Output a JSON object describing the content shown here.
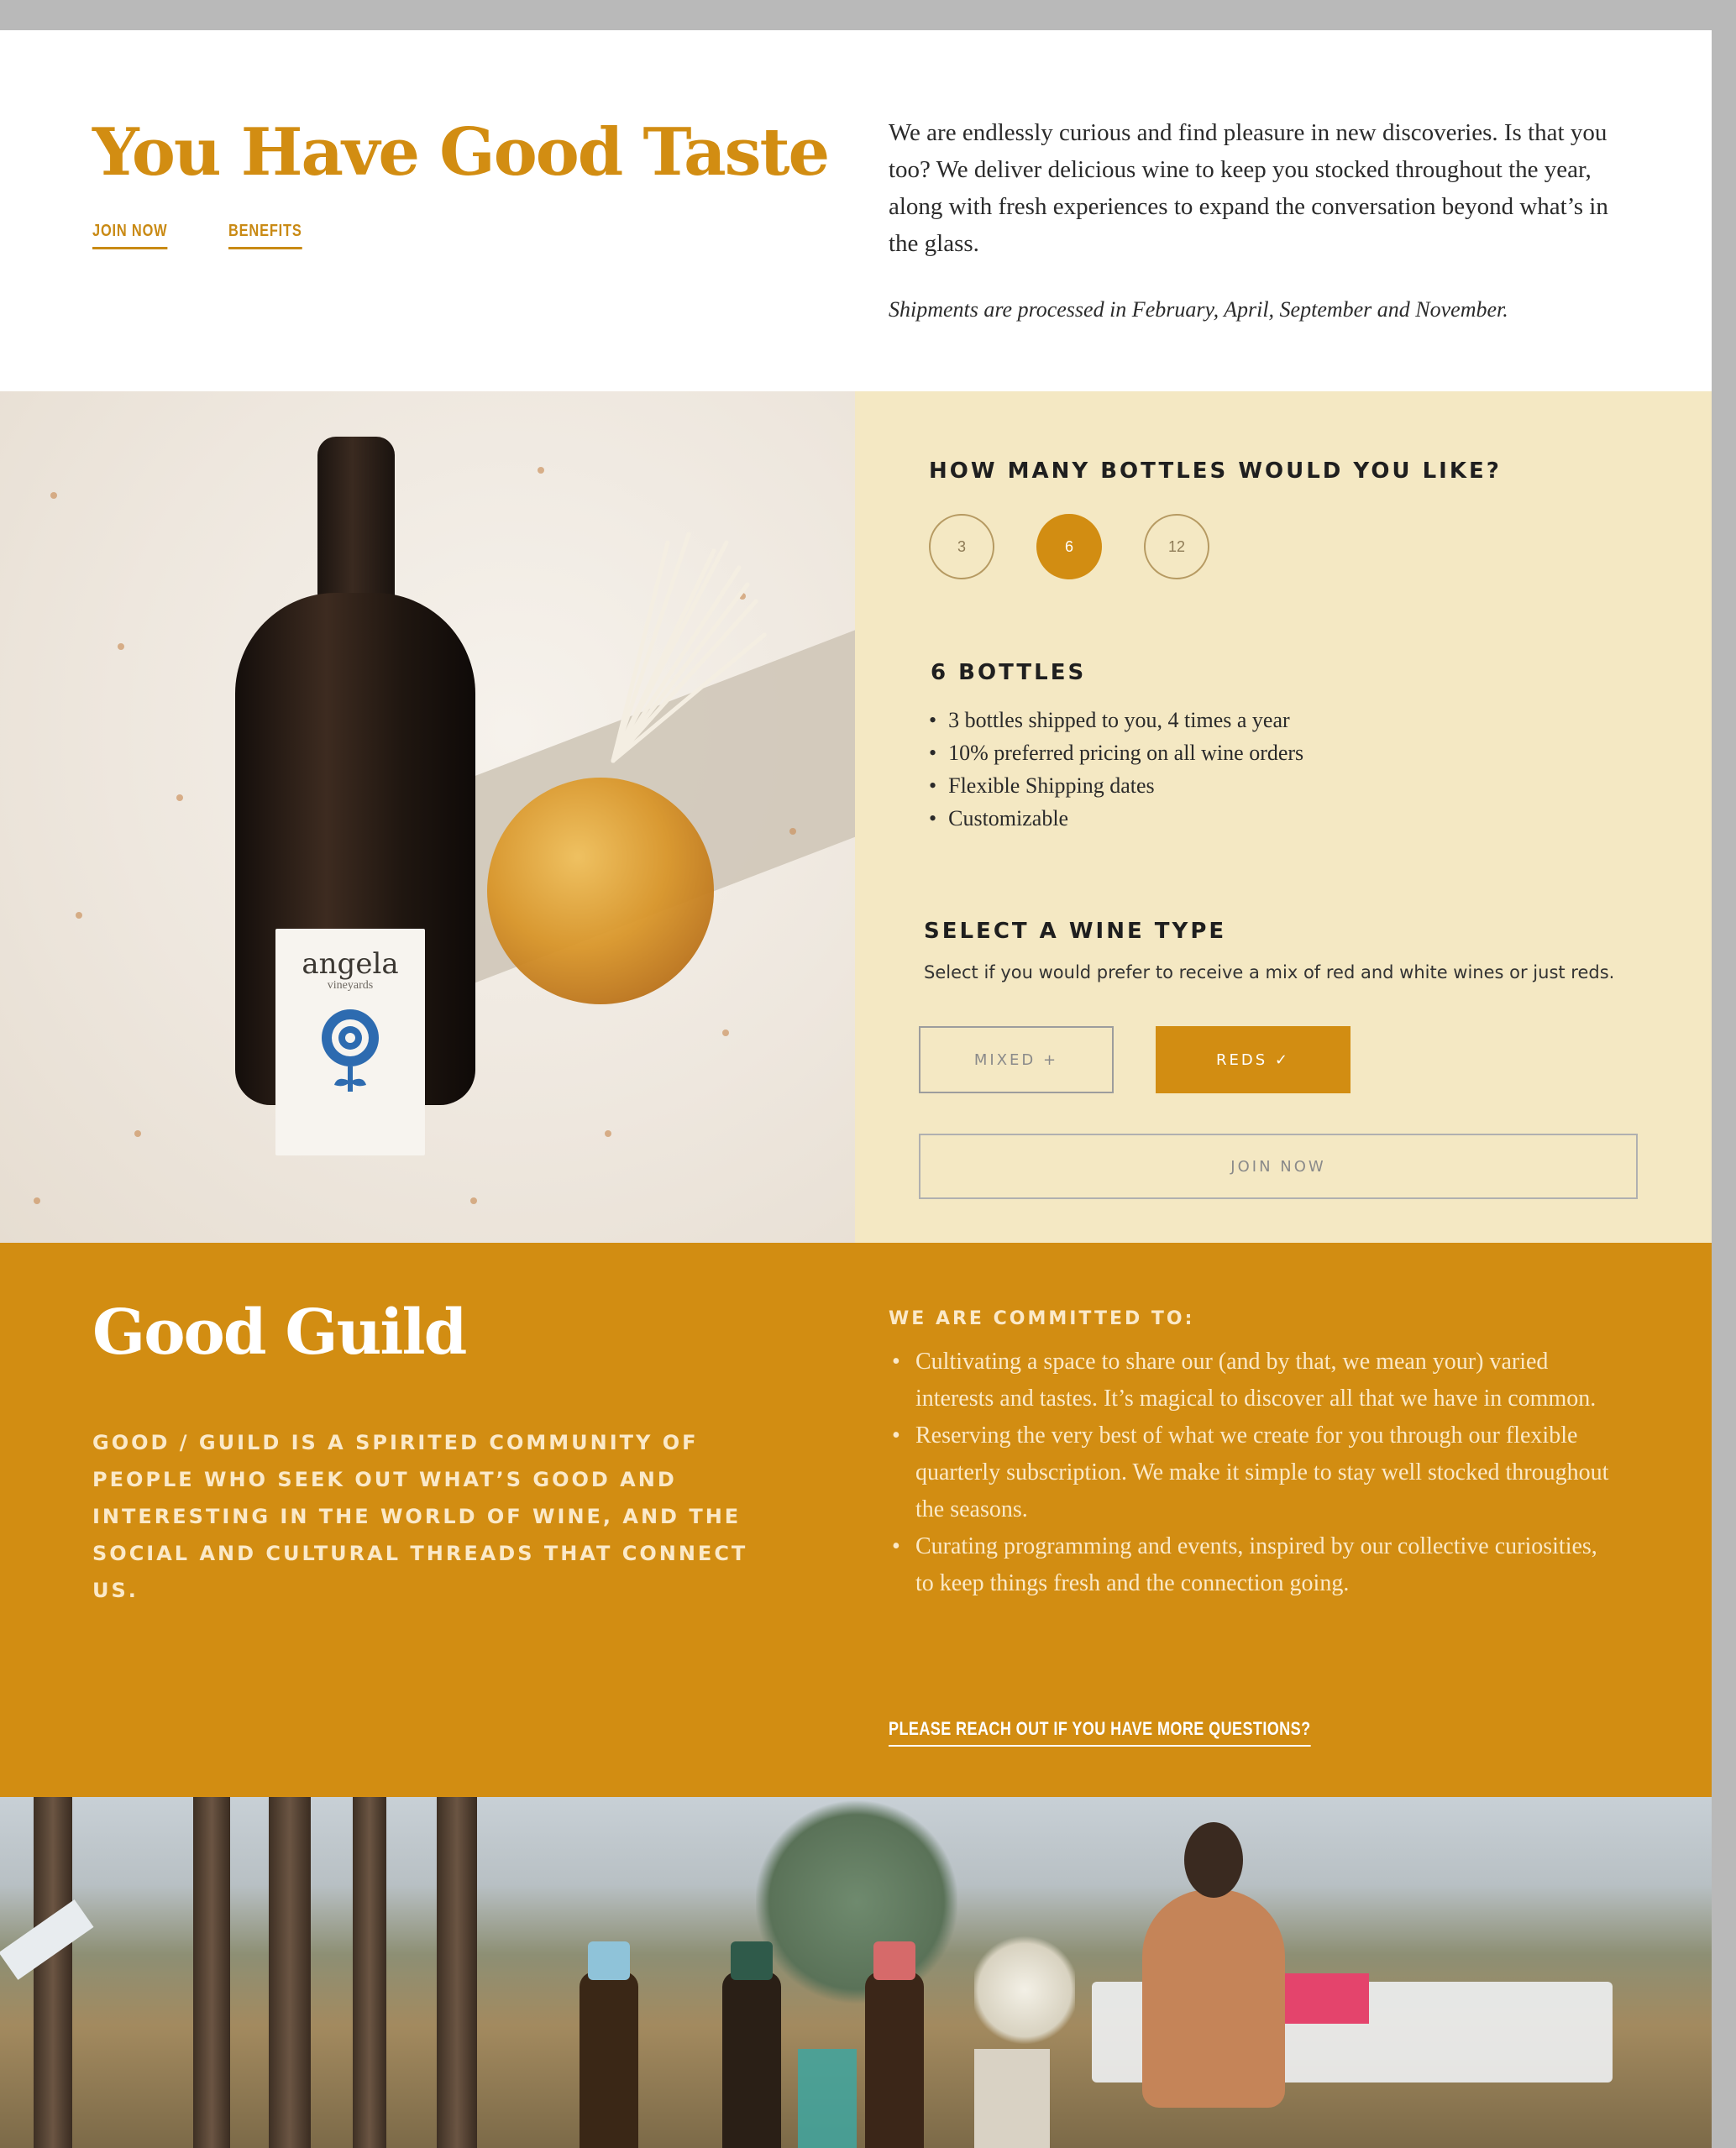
{
  "intro": {
    "title": "You Have Good Taste",
    "links": {
      "join": "JOIN NOW",
      "benefits": "BENEFITS"
    },
    "description": "We are endlessly curious and find pleasure in new discoveries. Is that you too? We deliver delicious wine to keep you stocked throughout the year, along with fresh experiences to expand the conversation beyond what’s in the glass.",
    "note": "Shipments are processed in February, April, September and November."
  },
  "product_photo": {
    "label_brand": "angela",
    "label_sub": "vineyards"
  },
  "config": {
    "bottles_heading": "HOW MANY BOTTLES WOULD YOU LIKE?",
    "quantities": [
      "3",
      "6",
      "12"
    ],
    "selected_quantity": "6",
    "selection_heading": "6 BOTTLES",
    "benefits": [
      "3 bottles shipped to you, 4 times a year",
      "10% preferred pricing on all wine orders",
      "Flexible Shipping dates",
      "Customizable"
    ],
    "wine_type_heading": "SELECT A WINE TYPE",
    "wine_type_desc": "Select if you would prefer to receive a mix of red and white wines or just reds.",
    "mixed_label": "MIXED +",
    "reds_label": "REDS ✓",
    "join_label": "JOIN NOW"
  },
  "guild": {
    "title": "Good Guild",
    "description": "GOOD / GUILD IS A SPIRITED COMMUNITY OF PEOPLE WHO SEEK OUT WHAT’S GOOD AND INTERESTING IN THE WORLD OF WINE, AND THE SOCIAL AND CULTURAL THREADS THAT CONNECT US.",
    "commit_heading": "WE ARE COMMITTED TO:",
    "commitments": [
      "Cultivating a space to share our (and by that, we mean your) varied interests and tastes. It’s magical to discover all that we have in common.",
      "Reserving the very best of what we create for you through our flexible quarterly subscription. We make it simple to stay well stocked throughout the seasons.",
      "Curating programming and events, inspired by our collective curiosities, to keep things fresh and the connection going."
    ],
    "contact_link": "PLEASE REACH OUT IF YOU HAVE MORE QUESTIONS?"
  },
  "colors": {
    "accent": "#d28d12",
    "cream_panel": "#f4e8c3",
    "text_dark": "#2b2b2b"
  }
}
